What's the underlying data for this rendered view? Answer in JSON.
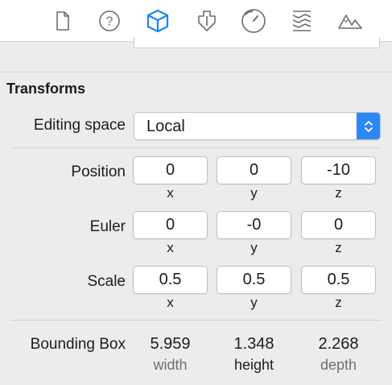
{
  "toolbar": {
    "tabs": [
      {
        "icon": "file-icon",
        "active": false
      },
      {
        "icon": "help-icon",
        "active": false
      },
      {
        "icon": "cube-icon",
        "active": true
      },
      {
        "icon": "attachment-icon",
        "active": false
      },
      {
        "icon": "gauge-icon",
        "active": false
      },
      {
        "icon": "texture-icon",
        "active": false
      },
      {
        "icon": "mountain-icon",
        "active": false
      }
    ],
    "active_color": "#1d86f0",
    "inactive_color": "#6d6d6d"
  },
  "transforms": {
    "title": "Transforms",
    "editing_space": {
      "label": "Editing space",
      "value": "Local"
    },
    "position": {
      "label": "Position",
      "x": "0",
      "y": "0",
      "z": "-10"
    },
    "euler": {
      "label": "Euler",
      "x": "0",
      "y": "-0",
      "z": "0"
    },
    "scale": {
      "label": "Scale",
      "x": "0.5",
      "y": "0.5",
      "z": "0.5"
    },
    "axis_labels": {
      "x": "x",
      "y": "y",
      "z": "z"
    }
  },
  "bounding_box": {
    "label": "Bounding Box",
    "width_value": "5.959",
    "width_label": "width",
    "height_value": "1.348",
    "height_label": "height",
    "depth_value": "2.268",
    "depth_label": "depth"
  }
}
